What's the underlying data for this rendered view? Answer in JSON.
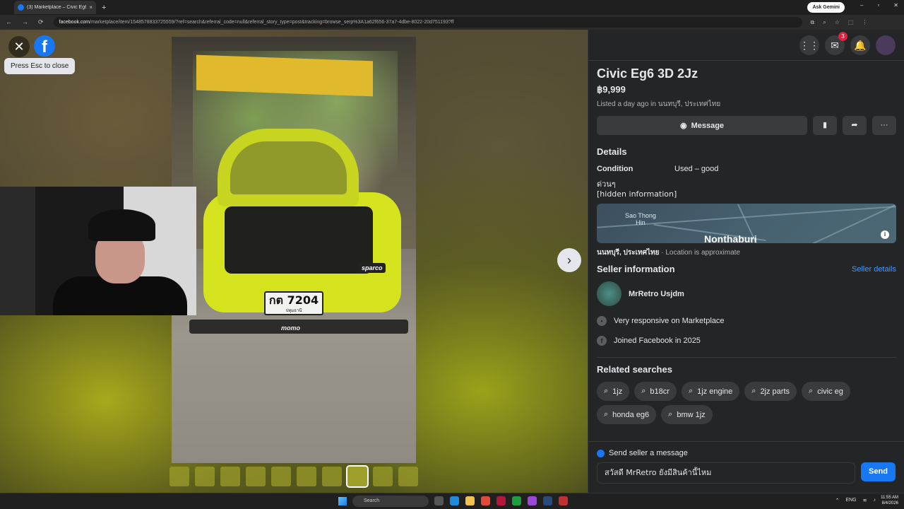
{
  "browser": {
    "tab_title": "(3) Marketplace – Civic Eg6 3D",
    "tab_close": "×",
    "new_tab": "+",
    "ask_gemini": "Ask Gemini",
    "url_domain": "facebook.com",
    "url_path": "/marketplace/item/1548578833725559/?ref=search&referral_code=null&referral_story_type=post&tracking=browse_serp%3A1a62f656-37a7-4dbe-8022-20d751193?ff",
    "window_min": "–",
    "window_max": "▫",
    "window_close": "✕"
  },
  "viewer": {
    "close_glyph": "✕",
    "fb_glyph": "f",
    "esc_tooltip": "Press Esc to close",
    "next_glyph": "›",
    "plate_number": "กต 7204",
    "plate_province": "ปทุมธานี",
    "sponsor_text": "momo",
    "sticker_text": "sparco",
    "thumbnail_count": 10,
    "active_thumbnail": 8
  },
  "header": {
    "notification_count": "3"
  },
  "listing": {
    "title": "Civic Eg6 3D 2Jz",
    "price": "฿9,999",
    "listed_prefix": "Listed a day ago in",
    "listed_location": "นนทบุรี, ประเทศไทย",
    "message_button": "Message"
  },
  "details": {
    "heading": "Details",
    "condition_label": "Condition",
    "condition_value": "Used – good",
    "desc_line1": "ด่วนๆ",
    "desc_line2": "[hidden information]"
  },
  "map": {
    "label_small": "Sao Thong\nHin",
    "label_big": "Nonthaburi",
    "info_glyph": "i",
    "location": "นนทบุรี, ประเทศไทย",
    "approx": "· Location is approximate"
  },
  "seller": {
    "heading": "Seller information",
    "details_link": "Seller details",
    "name": "MrRetro Usjdm",
    "responsive": "Very responsive on Marketplace",
    "joined": "Joined Facebook in 2025"
  },
  "related": {
    "heading": "Related searches",
    "chips": [
      "1jz",
      "b18cr",
      "1jz engine",
      "2jz parts",
      "civic eg",
      "honda eg6",
      "bmw 1jz"
    ]
  },
  "send": {
    "label": "Send seller a message",
    "input_value": "สวัสดี MrRetro ยังมีสินค้านี้ไหม",
    "send_button": "Send"
  },
  "taskbar": {
    "search_placeholder": "Search",
    "lang": "ENG",
    "time": "11:55 AM",
    "date": "8/4/2026"
  },
  "colors": {
    "accent": "#1877f2",
    "panel_bg": "#242526",
    "badge": "#e41e3f"
  }
}
